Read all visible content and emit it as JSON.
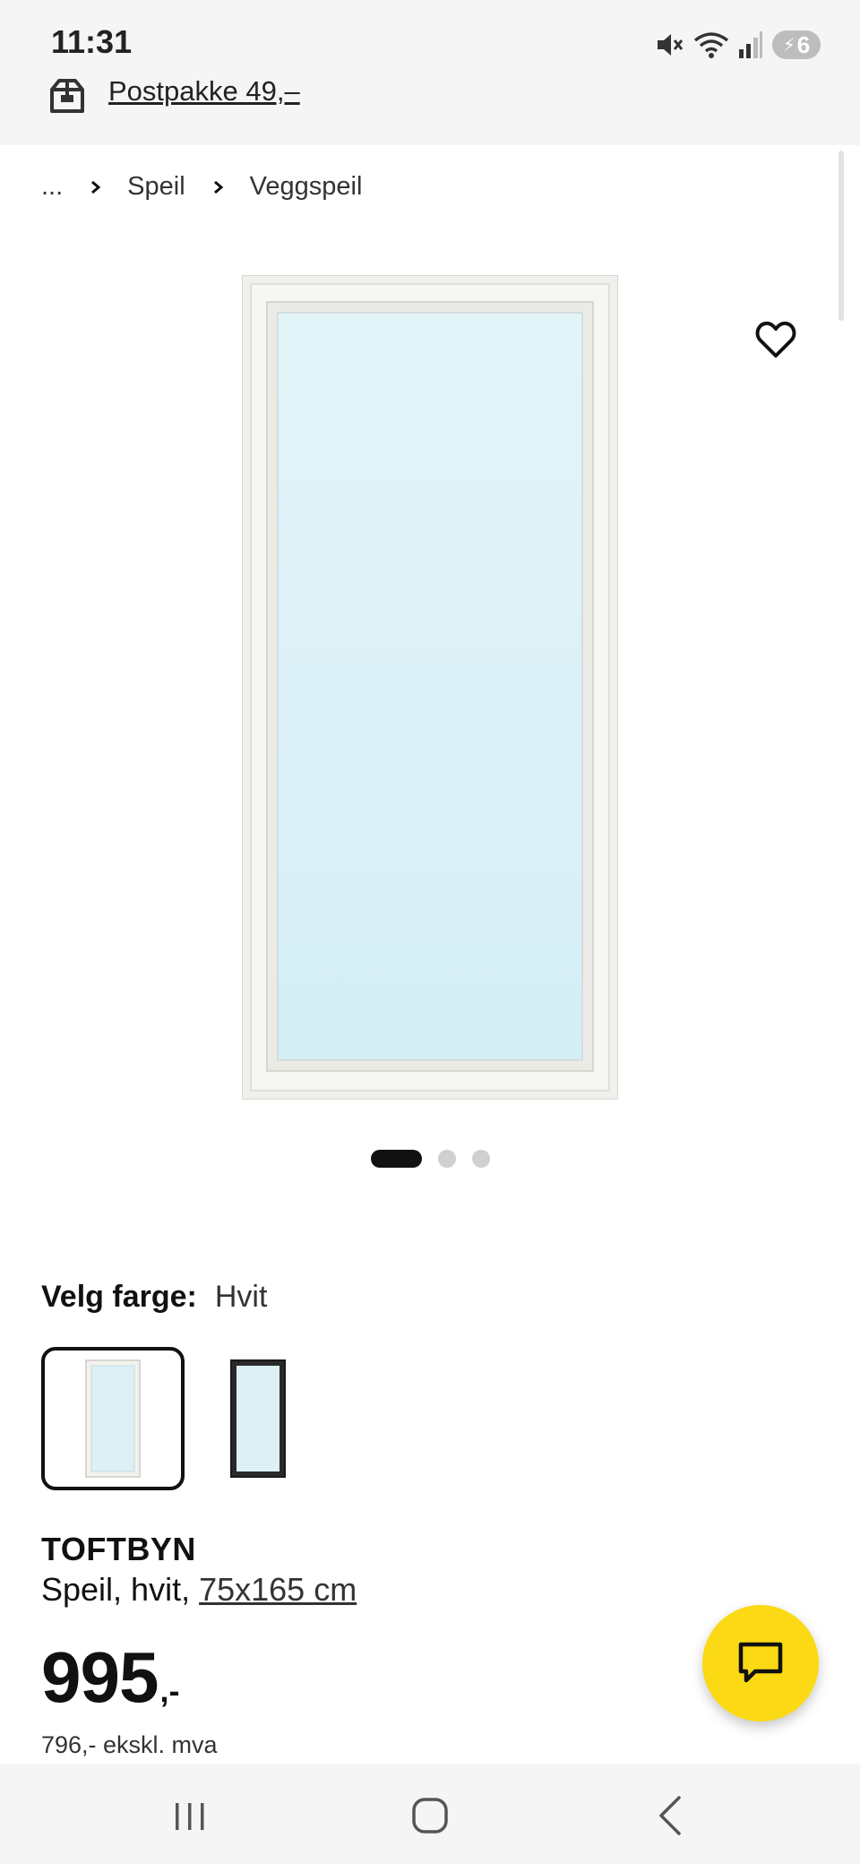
{
  "status_bar": {
    "time": "11:31",
    "battery_level": "6",
    "icons": [
      "mute-icon",
      "wifi-icon",
      "signal-icon",
      "battery-charging-icon"
    ]
  },
  "delivery": {
    "text": "Postpakke 49,–",
    "icon": "package-icon"
  },
  "breadcrumb": {
    "items": [
      "...",
      "Speil",
      "Veggspeil"
    ]
  },
  "gallery": {
    "image_count": 3,
    "active_index": 0
  },
  "color_selector": {
    "label": "Velg farge:",
    "value": "Hvit",
    "options": [
      {
        "name": "hvit",
        "frame_color": "#f2f2ee",
        "selected": true
      },
      {
        "name": "svart",
        "frame_color": "#2a2a2a",
        "selected": false
      }
    ]
  },
  "product": {
    "name": "TOFTBYN",
    "description": "Speil, hvit,",
    "size": "75x165 cm",
    "price": "995",
    "price_suffix": ",-",
    "price_ex_vat": "796,- ekskl. mva"
  },
  "colors": {
    "accent_yellow": "#fbd914",
    "text_primary": "#111111",
    "background_gray": "#f5f5f5",
    "mirror_glass": "#d9eef4"
  },
  "nav": {
    "items": [
      "recent-apps-icon",
      "home-icon",
      "back-icon"
    ]
  }
}
